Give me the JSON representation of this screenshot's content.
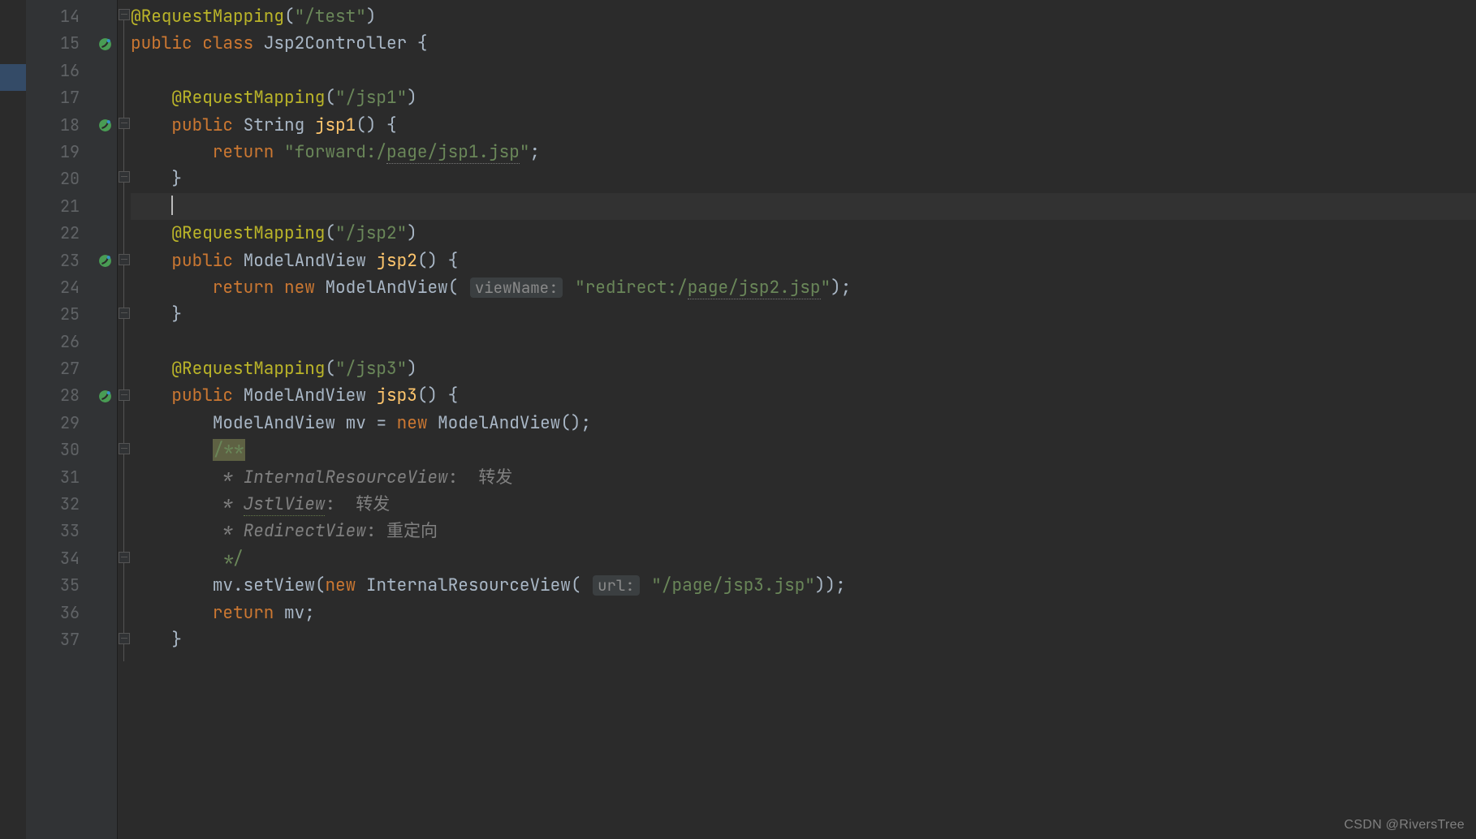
{
  "watermark": "CSDN @RiversTree",
  "gutter": {
    "lines": [
      "14",
      "15",
      "16",
      "17",
      "18",
      "19",
      "20",
      "21",
      "22",
      "23",
      "24",
      "25",
      "26",
      "27",
      "28",
      "29",
      "30",
      "31",
      "32",
      "33",
      "34",
      "35",
      "36",
      "37"
    ]
  },
  "code": {
    "l14": {
      "ann": "@RequestMapping",
      "paren_l": "(",
      "str": "\"/test\"",
      "paren_r": ")"
    },
    "l15": {
      "kw1": "public",
      "kw2": "class",
      "name": "Jsp2Controller",
      "brace": "{"
    },
    "l17": {
      "ann": "@RequestMapping",
      "paren_l": "(",
      "str": "\"/jsp1\"",
      "paren_r": ")"
    },
    "l18": {
      "kw": "public",
      "type": "String",
      "name": "jsp1",
      "sig": "() {"
    },
    "l19": {
      "kw": "return",
      "str_pre": "\"forward:/",
      "str_ul": "page/jsp1.jsp",
      "str_post": "\"",
      "semi": ";"
    },
    "l20": {
      "brace": "}"
    },
    "l22": {
      "ann": "@RequestMapping",
      "paren_l": "(",
      "str": "\"/jsp2\"",
      "paren_r": ")"
    },
    "l23": {
      "kw": "public",
      "type": "ModelAndView",
      "name": "jsp2",
      "sig": "() {"
    },
    "l24": {
      "kw": "return",
      "kw2": "new",
      "ctor": "ModelAndView",
      "paren_l": "(",
      "hint": "viewName:",
      "str_pre": "\"redirect:/",
      "str_ul": "page/jsp2.jsp",
      "str_post": "\"",
      "paren_r": ")",
      "semi": ";"
    },
    "l25": {
      "brace": "}"
    },
    "l27": {
      "ann": "@RequestMapping",
      "paren_l": "(",
      "str": "\"/jsp3\"",
      "paren_r": ")"
    },
    "l28": {
      "kw": "public",
      "type": "ModelAndView",
      "name": "jsp3",
      "sig": "() {"
    },
    "l29": {
      "type": "ModelAndView",
      "var": "mv",
      "eq": "=",
      "kw": "new",
      "ctor": "ModelAndView",
      "call": "();"
    },
    "l30": {
      "doc_open": "/**"
    },
    "l31": {
      "pre": " * ",
      "term": "InternalResourceView",
      "post": ":  转发"
    },
    "l32": {
      "pre": " * ",
      "term": "JstlView",
      "post": ":  转发"
    },
    "l33": {
      "pre": " * ",
      "term": "RedirectView",
      "post": ": 重定向"
    },
    "l34": {
      "doc_close": " */"
    },
    "l35": {
      "obj": "mv",
      "dot": ".",
      "method": "setView",
      "paren_l": "(",
      "kw": "new",
      "ctor": "InternalResourceView",
      "paren_l2": "(",
      "hint": "url:",
      "str": "\"/page/jsp3.jsp\"",
      "paren_r": "))",
      "semi": ";"
    },
    "l36": {
      "kw": "return",
      "var": "mv",
      "semi": ";"
    },
    "l37": {
      "brace": "}"
    }
  }
}
